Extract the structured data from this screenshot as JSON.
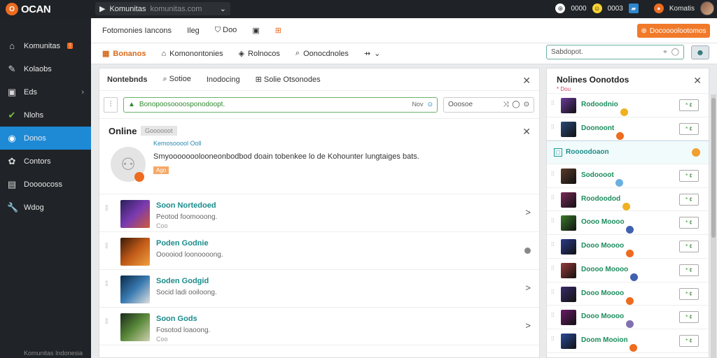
{
  "app": {
    "logo_text": "OCAN",
    "logo_mark": "O"
  },
  "addressbar": {
    "title": "Komunitas",
    "url": "komunitas.com"
  },
  "top_right": {
    "label_a": "0000",
    "label_b": "0003",
    "user_name": "Komatis"
  },
  "sidebar": {
    "items": [
      {
        "label": "Komunitas",
        "icon": "home-icon",
        "glyph": "⌂",
        "badge": "!"
      },
      {
        "label": "Kolaobs",
        "icon": "pencil-icon",
        "glyph": "✎"
      },
      {
        "label": "Eds",
        "icon": "chat-icon",
        "glyph": "▣",
        "chevron": "›"
      },
      {
        "label": "Nlohs",
        "icon": "leaf-icon",
        "glyph": "✔"
      },
      {
        "label": "Donos",
        "icon": "user-icon",
        "glyph": "◉",
        "active": true
      },
      {
        "label": "Contors",
        "icon": "gear-icon",
        "glyph": "✿"
      },
      {
        "label": "Doooocoss",
        "icon": "book-icon",
        "glyph": "▤"
      },
      {
        "label": "Wdog",
        "icon": "tool-icon",
        "glyph": "🔧"
      }
    ],
    "footer": "Komunitas Indonesia"
  },
  "toolbar": {
    "items": [
      "Fotomonies Iancons",
      "Ileg",
      "Doo"
    ],
    "orange_button": "Docoooolootomos"
  },
  "tabs": [
    {
      "label": "Bonanos",
      "active": true
    },
    {
      "label": "Komonontonies"
    },
    {
      "label": "Rolnocos"
    },
    {
      "label": "Oonocdnoles"
    }
  ],
  "tab_more": "⌄",
  "search_top": {
    "value": "Sabdopot."
  },
  "main": {
    "head_items": [
      "Nontebnds",
      "Sotioe",
      "Inodocing",
      "Solie Otsonodes"
    ],
    "filter_value": "Bonopoosoooosponodoopt.",
    "filter_tail": "Nov",
    "sort_label": "Ooosoe",
    "online": {
      "title": "Online",
      "chip": "Goooooot",
      "link": "Kemosooool Ooll",
      "desc": "Smyooooooolooneonbodbod doain tobenkee lo de Kohounter lungtaiges bats.",
      "tag": "Ago"
    },
    "games": [
      {
        "name": "Soon Nortedoed",
        "desc": "Peotod foomooong.",
        "sub": "Coo",
        "action": ">"
      },
      {
        "name": "Poden Godnie",
        "desc": "Ooooiod loonoooong.",
        "sub": "",
        "action": "dot"
      },
      {
        "name": "Soden Godgid",
        "desc": "Socid ladi ooiloong.",
        "sub": "",
        "action": ">"
      },
      {
        "name": "Soon Gods",
        "desc": "Fosotod loaoong.",
        "sub": "Coo",
        "action": ">"
      }
    ]
  },
  "friends": {
    "title": "Nolines Oonotdos",
    "mini": "* Dou",
    "rows": [
      {
        "name": "Rodoodnio",
        "status_color": "#f0b020",
        "btn": "* ¢"
      },
      {
        "name": "Doonoont",
        "status_color": "#ee6b1f",
        "btn": "* ¢"
      },
      {
        "name": "Roooodoaon",
        "highlight": true
      },
      {
        "name": "Sodoooot",
        "status_color": "#6ab0e0",
        "btn": "* ¢"
      },
      {
        "name": "Roodoodod",
        "status_color": "#f0b020",
        "btn": "* ¢"
      },
      {
        "name": "Oooo Moooo",
        "status_color": "#4060b0",
        "btn": "* ¢"
      },
      {
        "name": "Dooo Moooo",
        "status_color": "#ee6b1f",
        "btn": "* ¢"
      },
      {
        "name": "Doooo Moooo",
        "status_color": "#4060b0",
        "btn": "* ¢"
      },
      {
        "name": "Dooo Moooo",
        "status_color": "#ee6b1f",
        "btn": "* ¢"
      },
      {
        "name": "Dooo Moooo",
        "status_color": "#8070b0",
        "btn": "* ¢"
      },
      {
        "name": "Doom Mooion",
        "status_color": "#ee6b1f",
        "btn": "* ¢"
      }
    ]
  },
  "colors": {
    "accent": "#1e8ad6",
    "brand": "#ee6b1f",
    "green": "#6ab36a"
  }
}
